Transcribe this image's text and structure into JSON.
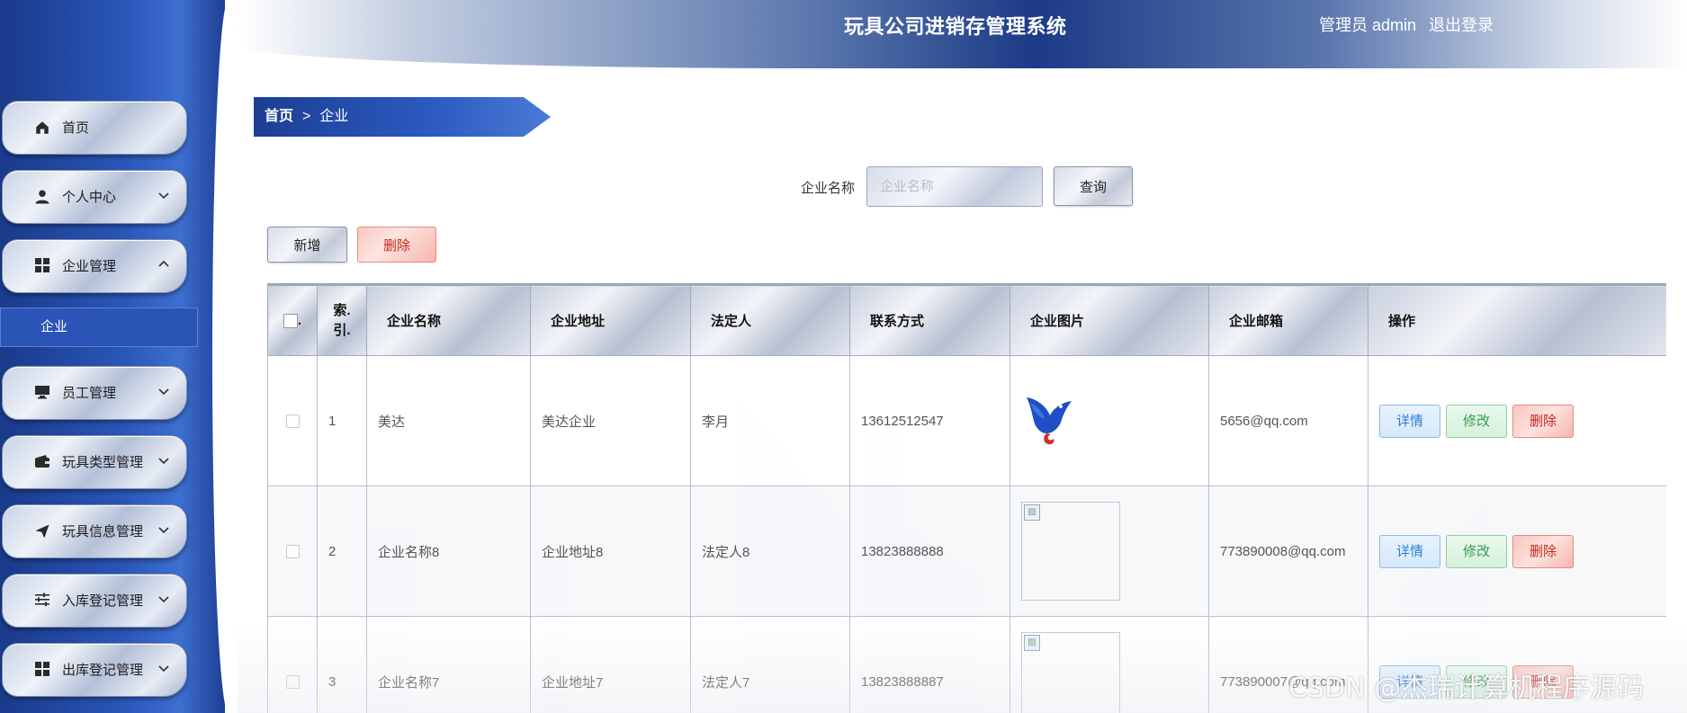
{
  "header": {
    "title": "玩具公司进销存管理系统",
    "user": "管理员 admin",
    "logout": "退出登录"
  },
  "sidebar": {
    "items": [
      {
        "label": "首页",
        "icon": "home-icon",
        "expandable": false
      },
      {
        "label": "个人中心",
        "icon": "user-icon",
        "expandable": true,
        "expanded": false
      },
      {
        "label": "企业管理",
        "icon": "grid-icon",
        "expandable": true,
        "expanded": true
      },
      {
        "label": "员工管理",
        "icon": "monitor-icon",
        "expandable": true,
        "expanded": false
      },
      {
        "label": "玩具类型管理",
        "icon": "wallet-icon",
        "expandable": true,
        "expanded": false
      },
      {
        "label": "玩具信息管理",
        "icon": "send-icon",
        "expandable": true,
        "expanded": false
      },
      {
        "label": "入库登记管理",
        "icon": "sliders-icon",
        "expandable": true,
        "expanded": false
      },
      {
        "label": "出库登记管理",
        "icon": "grid-icon",
        "expandable": true,
        "expanded": false
      }
    ],
    "submenu": {
      "label": "企业"
    }
  },
  "breadcrumb": {
    "home": "首页",
    "separator": ">",
    "current": "企业"
  },
  "search": {
    "label": "企业名称",
    "placeholder": "企业名称",
    "value": "",
    "button": "查询"
  },
  "toolbar": {
    "add": "新增",
    "delete": "删除"
  },
  "table": {
    "headers": {
      "check": ".",
      "index_line1": "索.",
      "index_line2": "引.",
      "name": "企业名称",
      "address": "企业地址",
      "legal": "法定人",
      "contact": "联系方式",
      "image": "企业图片",
      "email": "企业邮箱",
      "ops": "操作"
    },
    "rows": [
      {
        "index": "1",
        "name": "美达",
        "address": "美达企业",
        "legal": "李月",
        "contact": "13612512547",
        "image": "eagle-logo",
        "email": "5656@qq.com"
      },
      {
        "index": "2",
        "name": "企业名称8",
        "address": "企业地址8",
        "legal": "法定人8",
        "contact": "13823888888",
        "image": "broken",
        "email": "773890008@qq.com"
      },
      {
        "index": "3",
        "name": "企业名称7",
        "address": "企业地址7",
        "legal": "法定人7",
        "contact": "13823888887",
        "image": "broken",
        "email": "773890007@qq.com"
      }
    ],
    "ops": {
      "detail": "详情",
      "edit": "修改",
      "delete": "删除"
    }
  },
  "watermark": "CSDN @杰瑞计算机程序源码",
  "colors": {
    "sidebar_blue": "#2a56b8",
    "header_dark": "#1c3a86",
    "danger": "#c4281c",
    "info": "#2e7dd6",
    "success": "#3a9a4f"
  }
}
